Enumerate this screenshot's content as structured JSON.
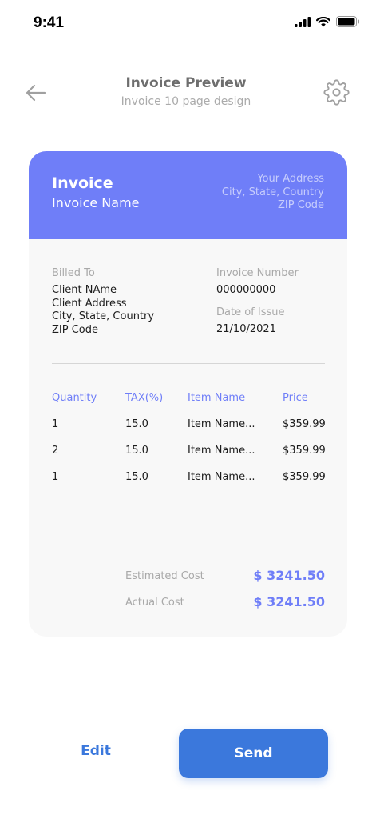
{
  "status_bar": {
    "time": "9:41"
  },
  "header": {
    "title": "Invoice Preview",
    "subtitle": "Invoice 10 page design"
  },
  "invoice": {
    "title": "Invoice",
    "name": "Invoice Name",
    "address": [
      "Your Address",
      "City, State, Country",
      "ZIP Code"
    ],
    "billed_to_label": "Billed To",
    "billed_to": [
      "Client NAme",
      "Client Address",
      "City, State, Country",
      "ZIP Code"
    ],
    "invoice_number_label": "Invoice Number",
    "invoice_number": "000000000",
    "date_label": "Date of Issue",
    "date": "21/10/2021",
    "columns": [
      "Quantity",
      "TAX(%)",
      "Item Name",
      "Price"
    ],
    "rows": [
      {
        "quantity": "1",
        "tax": "15.0",
        "item": "Item Name...",
        "price": "$359.99"
      },
      {
        "quantity": "2",
        "tax": "15.0",
        "item": "Item Name...",
        "price": "$359.99"
      },
      {
        "quantity": "1",
        "tax": "15.0",
        "item": "Item Name...",
        "price": "$359.99"
      }
    ],
    "estimated_cost_label": "Estimated Cost",
    "estimated_cost": "$ 3241.50",
    "actual_cost_label": "Actual Cost",
    "actual_cost": "$ 3241.50"
  },
  "actions": {
    "edit_label": "Edit",
    "send_label": "Send"
  },
  "colors": {
    "accent": "#6f7ef8",
    "primary_button": "#3b78dc",
    "card_background": "#f8f8f8"
  },
  "icons": {
    "back": "arrow-left-icon",
    "settings": "gear-icon",
    "signal": "signal-icon",
    "wifi": "wifi-icon",
    "battery": "battery-icon"
  }
}
